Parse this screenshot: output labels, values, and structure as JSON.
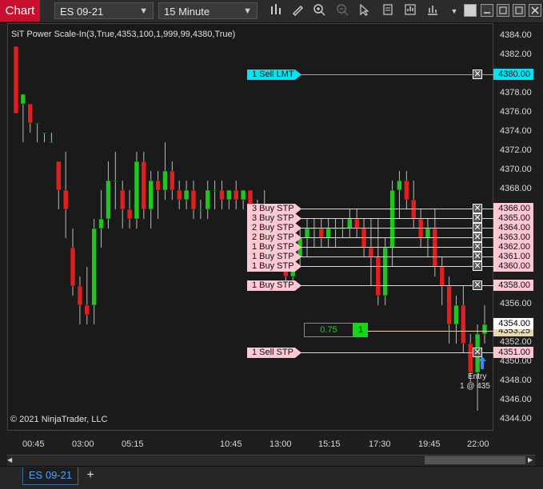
{
  "toolbar": {
    "chart_tab": "Chart",
    "instrument": "ES 09-21",
    "interval": "15 Minute"
  },
  "indicator_label": "SiT Power Scale-In(3,True,4353,100,1,999,99,4380,True)",
  "copyright": "© 2021 NinjaTrader, LLC",
  "price_axis": [
    "4384.00",
    "4382.00",
    "4380.00",
    "4378.00",
    "4376.00",
    "4374.00",
    "4372.00",
    "4370.00",
    "4368.00",
    "4366.00",
    "4364.00",
    "4362.00",
    "4360.00",
    "4358.00",
    "4356.00",
    "4354.00",
    "4352.00",
    "4350.00",
    "4348.00",
    "4346.00",
    "4344.00"
  ],
  "time_axis": [
    "00:45",
    "03:00",
    "05:15",
    "10:45",
    "13:00",
    "15:15",
    "17:30",
    "19:45",
    "22:00"
  ],
  "orders": [
    {
      "label": "1  Sell LMT",
      "price": "4380.00",
      "kind": "cyan"
    },
    {
      "label": "3  Buy STP",
      "price": "4366.00",
      "kind": "pink"
    },
    {
      "label": "3  Buy STP",
      "price": "4365.00",
      "kind": "pink"
    },
    {
      "label": "2  Buy STP",
      "price": "4364.00",
      "kind": "pink"
    },
    {
      "label": "2  Buy STP",
      "price": "4363.00",
      "kind": "pink"
    },
    {
      "label": "1  Buy STP",
      "price": "4362.00",
      "kind": "pink"
    },
    {
      "label": "1  Buy STP",
      "price": "4361.00",
      "kind": "pink"
    },
    {
      "label": "1  Buy STP",
      "price": "4360.00",
      "kind": "pink"
    },
    {
      "label": "1  Buy STP",
      "price": "4358.00",
      "kind": "pink"
    },
    {
      "label": "1  Sell STP",
      "price": "4351.00",
      "kind": "pink"
    }
  ],
  "position": {
    "pnl": "0.75",
    "qty": "1",
    "avg_price": "4353.25"
  },
  "last_price": "4354.00",
  "entry_label": "Entry",
  "entry_detail": "1 @ 435",
  "bottom_tab": "ES 09-21",
  "colors": {
    "up": "#22c322",
    "down": "#e0201e",
    "cyan": "#00e5ef",
    "pink": "#ffc8d2"
  },
  "candles": [
    [
      4383,
      4376,
      4383,
      4376
    ],
    [
      4377,
      4378,
      4373,
      4378
    ],
    [
      4377,
      4377,
      4374,
      4375
    ],
    [
      4375,
      4375,
      4373,
      4375
    ],
    [
      4374,
      4374,
      4373,
      4374
    ],
    [
      4373,
      4374,
      4373,
      4373
    ],
    [
      4371,
      4371,
      4366,
      4368
    ],
    [
      4368,
      4372,
      4363,
      4366
    ],
    [
      4362,
      4364,
      4357,
      4358
    ],
    [
      4358,
      4359,
      4354,
      4356
    ],
    [
      4356,
      4360,
      4354,
      4355
    ],
    [
      4356,
      4365,
      4354,
      4364
    ],
    [
      4364,
      4368,
      4362,
      4365
    ],
    [
      4365,
      4371,
      4364,
      4369
    ],
    [
      4369,
      4372,
      4366,
      4369
    ],
    [
      4368,
      4369,
      4364,
      4366
    ],
    [
      4366,
      4368,
      4364,
      4365
    ],
    [
      4365,
      4372,
      4364,
      4371
    ],
    [
      4371,
      4372,
      4365,
      4366
    ],
    [
      4366,
      4370,
      4364,
      4369
    ],
    [
      4369,
      4370,
      4365,
      4368
    ],
    [
      4368,
      4373,
      4367,
      4370
    ],
    [
      4370,
      4371,
      4367,
      4368
    ],
    [
      4368,
      4369,
      4366,
      4367
    ],
    [
      4367,
      4369,
      4366,
      4368
    ],
    [
      4368,
      4369,
      4365,
      4366
    ],
    [
      4366,
      4367,
      4365,
      4366
    ],
    [
      4366,
      4369,
      4365,
      4368
    ],
    [
      4368,
      4369,
      4366,
      4368
    ],
    [
      4368,
      4369,
      4366,
      4367
    ],
    [
      4367,
      4368,
      4366,
      4368
    ],
    [
      4368,
      4369,
      4366,
      4367
    ],
    [
      4367,
      4368,
      4366,
      4368
    ],
    [
      4368,
      4368,
      4365,
      4366
    ],
    [
      4366,
      4367,
      4365,
      4366
    ],
    [
      4366,
      4368,
      4363,
      4364
    ],
    [
      4364,
      4365,
      4361,
      4362
    ],
    [
      4362,
      4363,
      4360,
      4361
    ],
    [
      4361,
      4362,
      4358,
      4359
    ],
    [
      4359,
      4362,
      4358,
      4361
    ],
    [
      4361,
      4364,
      4360,
      4363
    ],
    [
      4363,
      4365,
      4361,
      4364
    ],
    [
      4364,
      4365,
      4362,
      4364
    ],
    [
      4364,
      4365,
      4362,
      4363
    ],
    [
      4363,
      4365,
      4362,
      4364
    ],
    [
      4364,
      4365,
      4362,
      4364
    ],
    [
      4364,
      4365,
      4363,
      4364
    ],
    [
      4364,
      4366,
      4363,
      4365
    ],
    [
      4365,
      4366,
      4363,
      4364
    ],
    [
      4364,
      4365,
      4361,
      4362
    ],
    [
      4362,
      4365,
      4358,
      4361
    ],
    [
      4361,
      4365,
      4356,
      4357
    ],
    [
      4357,
      4363,
      4356,
      4362
    ],
    [
      4362,
      4369,
      4360,
      4368
    ],
    [
      4368,
      4370,
      4365,
      4369
    ],
    [
      4369,
      4370,
      4366,
      4367
    ],
    [
      4367,
      4369,
      4364,
      4365
    ],
    [
      4365,
      4366,
      4362,
      4363
    ],
    [
      4363,
      4365,
      4361,
      4364
    ],
    [
      4364,
      4366,
      4359,
      4360
    ],
    [
      4360,
      4361,
      4356,
      4358
    ],
    [
      4358,
      4359,
      4352,
      4354
    ],
    [
      4354,
      4357,
      4352,
      4356
    ],
    [
      4356,
      4358,
      4351,
      4352
    ],
    [
      4352,
      4353,
      4348,
      4349
    ],
    [
      4349,
      4354,
      4345,
      4353
    ],
    [
      4353,
      4356,
      4352,
      4354
    ]
  ]
}
